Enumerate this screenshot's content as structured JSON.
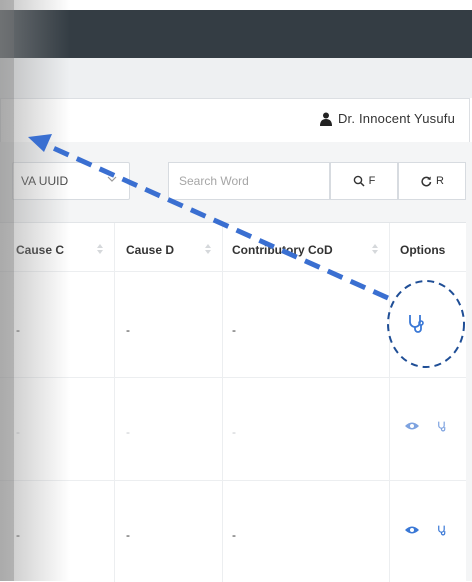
{
  "header": {
    "user_name": "Dr. Innocent Yusufu"
  },
  "toolbar": {
    "select_value": "VA UUID",
    "search_placeholder": "Search Word",
    "filter_label": "F",
    "reset_label": "R"
  },
  "table": {
    "columns": [
      "Cause C",
      "Cause D",
      "Contributory CoD",
      "Options"
    ],
    "rows": [
      {
        "cause_c": "-",
        "cause_d": "-",
        "contrib": "-"
      },
      {
        "cause_c": "-",
        "cause_d": "-",
        "contrib": "-"
      },
      {
        "cause_c": "-",
        "cause_d": "-",
        "contrib": "-"
      }
    ]
  },
  "icons": {
    "user": "user-icon",
    "search": "search-icon",
    "refresh": "refresh-icon",
    "view": "eye-icon",
    "stethoscope": "stethoscope-icon"
  },
  "colors": {
    "accent": "#3a78d6",
    "topbar": "#343d44"
  }
}
